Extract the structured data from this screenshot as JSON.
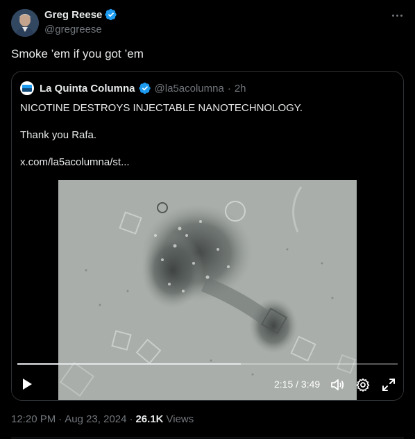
{
  "author": {
    "display_name": "Greg Reese",
    "handle": "@gregreese",
    "verified": true,
    "verified_color": "#1d9bf0"
  },
  "tweet": {
    "text": "Smoke ’em if you got ’em"
  },
  "quote": {
    "display_name": "La Quinta Columna",
    "handle": "@la5acolumna",
    "separator": "·",
    "time_ago": "2h",
    "line1": "NICOTINE DESTROYS INJECTABLE NANOTECHNOLOGY.",
    "line2": "Thank you Rafa.",
    "link": "x.com/la5acolumna/st..."
  },
  "video": {
    "time_display": "2:15 / 3:49",
    "progress_fraction": 0.587
  },
  "footer": {
    "time": "12:20 PM",
    "dot1": "·",
    "date": "Aug 23, 2024",
    "dot2": "·",
    "views_count": "26.1K",
    "views_label": "Views"
  },
  "icons": {
    "more": "more-icon",
    "verified": "verified-badge-icon",
    "play": "play-icon",
    "volume": "volume-icon",
    "settings": "gear-icon",
    "fullscreen": "expand-icon"
  }
}
